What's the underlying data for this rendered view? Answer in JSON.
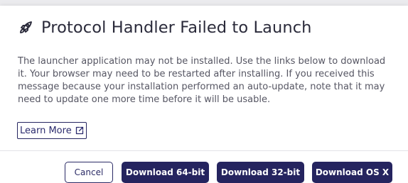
{
  "dialog": {
    "title": "Protocol Handler Failed to Launch",
    "title_icon": "rocket-icon",
    "message": "The launcher application may not be installed. Use the links below to download it. Your browser may need to be restarted after installing. If you received this message because your installation performed an auto-update, note that it may need to update one more time before it will be usable.",
    "learn_more": {
      "label": "Learn More",
      "icon": "external-link-icon"
    }
  },
  "footer": {
    "cancel_label": "Cancel",
    "download_64_label": "Download 64-bit",
    "download_32_label": "Download 32-bit",
    "download_osx_label": "Download OS X"
  },
  "colors": {
    "primary": "#25245f",
    "title_text": "#2a2a3a",
    "body_text": "#565663",
    "divider": "#e2e2e8"
  }
}
